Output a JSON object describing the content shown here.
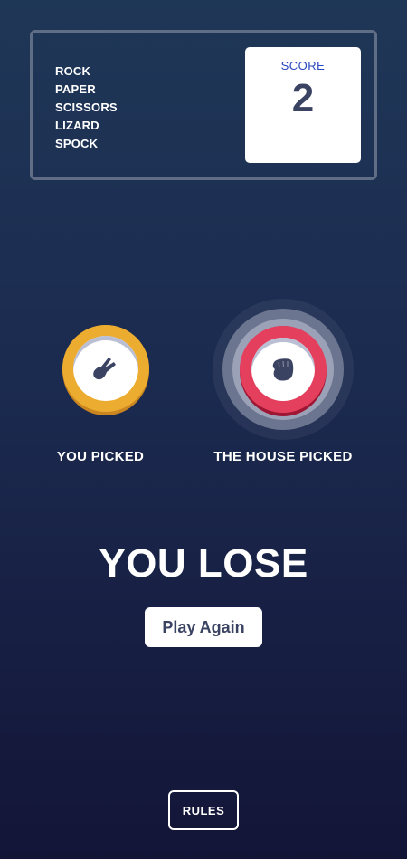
{
  "header": {
    "title_lines": [
      "ROCK",
      "PAPER",
      "SCISSORS",
      "LIZARD",
      "SPOCK"
    ],
    "score_label": "SCORE",
    "score_value": "2"
  },
  "user_pick": {
    "label": "YOU PICKED",
    "choice": "scissors",
    "icon": "scissors-hand-icon",
    "ring_color": "#ecac2f",
    "ring_shadow": "#c9851f"
  },
  "house_pick": {
    "label": "THE HOUSE PICKED",
    "choice": "rock",
    "icon": "fist-icon",
    "ring_color": "#e4405e",
    "ring_shadow": "#9d1634"
  },
  "result": {
    "text": "YOU LOSE",
    "play_again_label": "Play Again"
  },
  "footer": {
    "rules_label": "RULES"
  },
  "colors": {
    "background_top": "#1f3757",
    "background_bottom": "#131537",
    "header_border": "#606e85",
    "score_label": "#2a46c0",
    "dark_text": "#3b4363"
  }
}
